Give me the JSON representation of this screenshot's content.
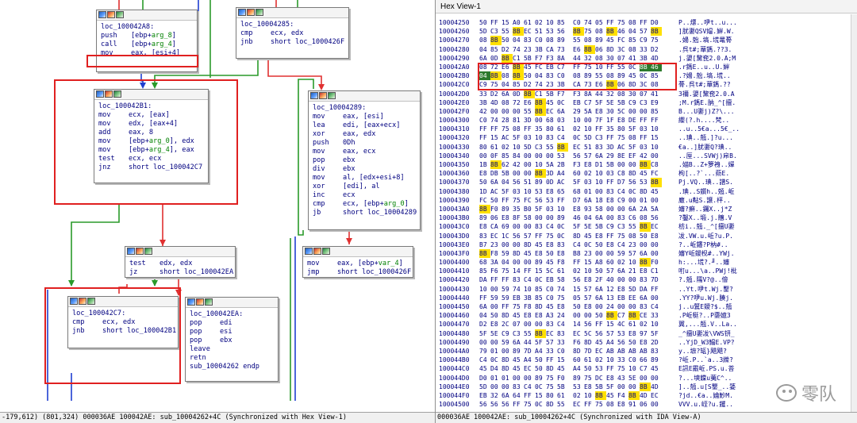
{
  "graph": {
    "status": "-179,612) (801,324) 000036AE 100042AE: sub_10004262+4C (Synchronized with Hex View-1)",
    "blocks": {
      "b1": {
        "label": "loc_100042A8:",
        "lines": [
          {
            "m": "push",
            "o": "[ebp+",
            "a": "arg_8",
            "t": "]"
          },
          {
            "m": "call",
            "o": "[ebp+",
            "a": "arg_4",
            "t": "]"
          },
          {
            "m": "mov",
            "o": "eax, [esi+4]",
            "a": "",
            "t": ""
          }
        ]
      },
      "b2": {
        "label": "loc_10004285:",
        "lines": [
          {
            "m": "cmp",
            "o": "ecx, edx",
            "a": "",
            "t": ""
          },
          {
            "m": "jnb",
            "o": "short loc_1000426F",
            "a": "",
            "t": ""
          }
        ]
      },
      "b3": {
        "label": "loc_100042B1:",
        "lines": [
          {
            "m": "mov",
            "o": "ecx, [eax]",
            "a": "",
            "t": ""
          },
          {
            "m": "mov",
            "o": "edx, [eax+4]",
            "a": "",
            "t": ""
          },
          {
            "m": "add",
            "o": "eax, 8",
            "a": "",
            "t": ""
          },
          {
            "m": "mov",
            "o": "[ebp+",
            "a": "arg_0",
            "t": "], edx"
          },
          {
            "m": "mov",
            "o": "[ebp+",
            "a": "arg_4",
            "t": "], eax"
          },
          {
            "m": "test",
            "o": "ecx, ecx",
            "a": "",
            "t": ""
          },
          {
            "m": "jnz",
            "o": "short loc_100042C7",
            "a": "",
            "t": ""
          }
        ]
      },
      "b4": {
        "label": "loc_10004289:",
        "lines": [
          {
            "m": "mov",
            "o": "eax, [esi]",
            "a": "",
            "t": ""
          },
          {
            "m": "lea",
            "o": "edi, [eax+ecx]",
            "a": "",
            "t": ""
          },
          {
            "m": "xor",
            "o": "eax, edx",
            "a": "",
            "t": ""
          },
          {
            "m": "push",
            "o": "0Dh",
            "a": "",
            "t": ""
          },
          {
            "m": "mov",
            "o": "eax, ecx",
            "a": "",
            "t": ""
          },
          {
            "m": "pop",
            "o": "ebx",
            "a": "",
            "t": ""
          },
          {
            "m": "div",
            "o": "ebx",
            "a": "",
            "t": ""
          },
          {
            "m": "mov",
            "o": "al, [edx+esi+8]",
            "a": "",
            "t": ""
          },
          {
            "m": "xor",
            "o": "[edi], al",
            "a": "",
            "t": ""
          },
          {
            "m": "inc",
            "o": "ecx",
            "a": "",
            "t": ""
          },
          {
            "m": "cmp",
            "o": "ecx, [ebp+",
            "a": "arg_0",
            "t": "]"
          },
          {
            "m": "jb",
            "o": "short loc_10004289",
            "a": "",
            "t": ""
          }
        ]
      },
      "b5": {
        "label": "",
        "lines": [
          {
            "m": "test",
            "o": "edx, edx",
            "a": "",
            "t": ""
          },
          {
            "m": "jz",
            "o": "short loc_100042EA",
            "a": "",
            "t": ""
          }
        ]
      },
      "b6": {
        "label": "",
        "lines": [
          {
            "m": "mov",
            "o": "eax, [ebp+",
            "a": "var_4",
            "t": "]"
          },
          {
            "m": "jmp",
            "o": "short loc_1000426F",
            "a": "",
            "t": ""
          }
        ]
      },
      "b7": {
        "label": "loc_100042C7:",
        "lines": [
          {
            "m": "cmp",
            "o": "ecx, edx",
            "a": "",
            "t": ""
          },
          {
            "m": "jnb",
            "o": "short loc_100042B1",
            "a": "",
            "t": ""
          }
        ]
      },
      "b8": {
        "label": "loc_100042EA:",
        "lines": [
          {
            "m": "pop",
            "o": "edi",
            "a": "",
            "t": ""
          },
          {
            "m": "pop",
            "o": "esi",
            "a": "",
            "t": ""
          },
          {
            "m": "pop",
            "o": "ebx",
            "a": "",
            "t": ""
          },
          {
            "m": "leave",
            "o": "",
            "a": "",
            "t": ""
          },
          {
            "m": "retn",
            "o": "",
            "a": "",
            "t": ""
          },
          {
            "m": "sub_10004262 endp",
            "o": "",
            "a": "",
            "t": ""
          }
        ]
      }
    }
  },
  "hex": {
    "title": "Hex View-1",
    "status": "000036AE 100042AE: sub_10004262+4C (Synchronized with IDA View-A)",
    "colors": {
      "highlight": "#ffe000",
      "cursor": "#2d7a2d",
      "redbox": "#e02020"
    },
    "rows": [
      {
        "addr": "10004250",
        "bytes": "50 FF 15 A0 61 02 10 85 C0 74 05 FF 75 08 FF D0",
        "hl": [],
        "ascii": "P..熛..吚t..u..."
      },
      {
        "addr": "10004260",
        "bytes": "5D C3 55 8B EC 51 53 56 8B 75 08 8B 46 04 57 8B",
        "hl": [
          3,
          8,
          11,
          15
        ],
        "ascii": "]肬嬱QSV媢.婩.W."
      },
      {
        "addr": "10004270",
        "bytes": "08 8B 50 04 83 C0 08 89 55 08 89 45 FC 85 C9 75",
        "hl": [
          1
        ],
        "ascii": ".婸.兝.塙.塃鼌蓇"
      },
      {
        "addr": "10004280",
        "bytes": "04 85 D2 74 23 3B CA 73 E6 8B 06 8D 3C 08 33 D2",
        "hl": [
          9
        ],
        "ascii": ".呉t#;蕇鎷.??3."
      },
      {
        "addr": "10004290",
        "bytes": "6A 0D 8B C1 5B F7 F3 8A 44 32 08 30 07 41 3B 4D",
        "hl": [
          2
        ],
        "ascii": "j.嬃[黧奃2.0.A;M"
      },
      {
        "addr": "100042A0",
        "bytes": "08 72 E6 8B 45 FC EB C7 FF 75 10 FF 55 0C 8B 46",
        "hl": [
          3
        ],
        "cursor": [
          14,
          15
        ],
        "ascii": ".r鎷E..u..U.婩"
      },
      {
        "addr": "100042B0",
        "bytes": "04 8B 08 8B 50 04 83 C0 08 89 55 08 89 45 0C 85",
        "hl": [
          1,
          3
        ],
        "cursor": [
          0
        ],
        "ascii": ".?婸.兝.塙.塃.."
      },
      {
        "addr": "100042C0",
        "bytes": "C9 75 04 85 D2 74 23 3B CA 73 E6 8B 06 8D 3C 08",
        "hl": [
          11
        ],
        "ascii": "蓇.呉t#;蕇鎷.??"
      },
      {
        "addr": "100042D0",
        "bytes": "33 D2 6A 0D 8B C1 5B F7 F3 8A 44 32 08 30 07 41",
        "hl": [
          4
        ],
        "ascii": "3襧.嬃[黧奃2.0.A"
      },
      {
        "addr": "100042E0",
        "bytes": "3B 4D 08 72 E6 8B 45 0C EB C7 5F 5E 5B C9 C3 E9",
        "hl": [
          5
        ],
        "ascii": ";M.r鎷E.肭_^[擅."
      },
      {
        "addr": "100042F0",
        "bytes": "42 00 00 00 55 8B EC 6A 29 5A E8 30 5C 00 00 85",
        "hl": [
          5
        ],
        "ascii": "B...U嬱j)Z?\\..."
      },
      {
        "addr": "10004300",
        "bytes": "C0 74 28 81 3D 00 68 03 10 00 7F 1F E8 DE FF FF",
        "hl": [],
        "ascii": "纓(?.h....梵.."
      },
      {
        "addr": "10004310",
        "bytes": "FF FF 75 08 FF 35 80 61 02 10 FF 35 80 5F 03 10",
        "hl": [],
        "ascii": "..u..5€a...5€_.."
      },
      {
        "addr": "10004320",
        "bytes": "FF 15 AC 5F 03 10 83 C4 0C 5D C3 FF 75 08 FF 15",
        "hl": [],
        "ascii": "..琠..兡.]?u..."
      },
      {
        "addr": "10004330",
        "bytes": "80 61 02 10 5D C3 55 8B EC 51 83 3D AC 5F 03 10",
        "hl": [
          7
        ],
        "ascii": "€a..]肬嬱Q?琠.."
      },
      {
        "addr": "10004340",
        "bytes": "00 0F 85 84 00 00 00 53 56 57 6A 29 8E EF 42 00",
        "hl": [],
        "ascii": "..厔...SVWj)帍B."
      },
      {
        "addr": "10004350",
        "bytes": "1B 8B 62 42 00 10 5A 2B F3 E8 D1 5B 00 00 8B C8",
        "hl": [
          1,
          14
        ],
        "ascii": ".媌B..Z+箩裑..嬋"
      },
      {
        "addr": "10004360",
        "bytes": "E8 DB 5B 00 00 8B 3D A4 60 02 10 03 C8 8D 45 FC",
        "hl": [
          5
        ],
        "ascii": "枸[..?`...葝E."
      },
      {
        "addr": "10004370",
        "bytes": "50 6A 04 56 51 89 0D AC 5F 03 10 FF D7 56 53 8B",
        "hl": [
          15
        ],
        "ascii": "Pj.VQ..琠..譜S."
      },
      {
        "addr": "10004380",
        "bytes": "1D AC 5F 03 10 53 E8 65 68 01 00 83 C4 0C 8D 45",
        "hl": [],
        "ascii": ".琠..S鑕h..兡.岴"
      },
      {
        "addr": "10004390",
        "bytes": "FC 50 FF 75 FC 56 53 FF D7 6A 18 E8 C9 00 01 00",
        "hl": [],
        "ascii": "黀.u黇S.譲.枰.."
      },
      {
        "addr": "100043A0",
        "bytes": "8B F0 89 35 B0 5F 03 10 E8 93 58 00 00 6A 2A 5A",
        "hl": [
          0
        ],
        "ascii": "嬸?癬..钃X..j*Z"
      },
      {
        "addr": "100043B0",
        "bytes": "89 06 E8 8F 58 00 00 89 46 04 6A 00 83 C6 08 56",
        "hl": [],
        "ascii": "?鑿X..塅.j.兤.V"
      },
      {
        "addr": "100043C0",
        "bytes": "E8 CA 69 00 00 83 C4 0C 5F 5E 5B C9 C3 55 8B EC",
        "hl": [
          14
        ],
        "ascii": "枋i..兡._^[擅U嬱"
      },
      {
        "addr": "100043D0",
        "bytes": "83 EC 1C 56 57 FF 75 0C 8D 45 E8 FF 75 08 50 E8",
        "hl": [],
        "ascii": "冹.VW.u.岴?u.P."
      },
      {
        "addr": "100043E0",
        "bytes": "B7 23 00 00 8D 45 E8 83 C4 0C 50 E8 C4 23 00 00",
        "hl": [],
        "ascii": "?..岴鑳?P枘#.."
      },
      {
        "addr": "100043F0",
        "bytes": "8B F8 59 8D 45 E8 50 E8 B8 23 00 00 59 57 6A 00",
        "hl": [
          0
        ],
        "ascii": "嬸Y岴鑀枧#..YWj."
      },
      {
        "addr": "10004400",
        "bytes": "68 3A 04 00 00 89 45 F8 FF 15 A8 60 02 10 8B F0",
        "hl": [
          14
        ],
        "ascii": "h:...塃?.╜..嬸"
      },
      {
        "addr": "10004410",
        "bytes": "85 F6 75 14 FF 15 5C 61 02 10 50 57 6A 21 E8 C1",
        "hl": [],
        "ascii": "咑u...\\a..PWj!枇"
      },
      {
        "addr": "10004420",
        "bytes": "DA FF FF 83 C4 0C EB 58 56 E8 2F 40 00 00 83 7D",
        "hl": [],
        "ascii": "?.兡.隭V?@..儈"
      },
      {
        "addr": "10004430",
        "bytes": "10 00 59 74 10 85 C0 74 15 57 6A 12 E8 5D DA FF",
        "hl": [],
        "ascii": "..Yt.吚t.Wj.鑋?"
      },
      {
        "addr": "10004440",
        "bytes": "FF 59 59 EB 3B 85 C0 75 05 57 6A 13 EB EE 6A 00",
        "hl": [],
        "ascii": ".YY?吚u.Wj.腠j."
      },
      {
        "addr": "10004450",
        "bytes": "6A 00 FF 75 F8 8D 45 E8 50 E8 00 24 00 00 83 C4",
        "hl": [],
        "ascii": "j..u鼚E鑀?$..兡"
      },
      {
        "addr": "10004460",
        "bytes": "04 50 8D 45 E8 E8 A3 24 00 00 50 8B C7 8B CE 33",
        "hl": [
          11,
          13
        ],
        "ascii": ".P岴梃?..P嬊嬑3"
      },
      {
        "addr": "10004470",
        "bytes": "D2 E8 2C 07 00 00 83 C4 14 56 FF 15 4C 61 02 10",
        "hl": [],
        "ascii": "翼,...兡.V..La.."
      },
      {
        "addr": "10004480",
        "bytes": "5F 5E C9 C3 55 8B EC 83 EC 5C 56 57 53 E8 97 5F",
        "hl": [
          5
        ],
        "ascii": "_^擅U嬱冹\\VWS钘_"
      },
      {
        "addr": "10004490",
        "bytes": "00 00 59 6A 44 5F 57 33 F6 8D 45 A4 56 50 E8 2D",
        "hl": [],
        "ascii": "..YjD_W3鰨E.VP?"
      },
      {
        "addr": "100044A0",
        "bytes": "79 01 00 89 7D A4 33 C0 8D 7D EC AB AB AB AB 83",
        "hl": [],
        "ascii": "y..墌?缻}飓飓?"
      },
      {
        "addr": "100044B0",
        "bytes": "C4 0C 8D 45 A4 50 FF 15 60 61 02 10 33 C0 66 89",
        "hl": [],
        "ascii": "?岴.P..`a..3纅?"
      },
      {
        "addr": "100044C0",
        "bytes": "45 D4 8D 45 EC 50 8D 45 A4 50 53 FF 75 10 C7 45",
        "hl": [],
        "ascii": "E訊E霵岴.PS.u.荅"
      },
      {
        "addr": "100044D0",
        "bytes": "D0 01 01 00 00 89 75 F0 89 75 DC E8 43 5E 00 00",
        "hl": [],
        "ascii": "?...塽饓u荑C^.."
      },
      {
        "addr": "100044E0",
        "bytes": "5D 00 00 83 C4 0C 75 5B 53 E8 5B 5F 00 00 8B 4D",
        "hl": [
          14
        ],
        "ascii": "]..兡.u[S鑋_..婱"
      },
      {
        "addr": "100044F0",
        "bytes": "EB 32 6A 64 FF 15 80 61 02 10 8B 45 F4 8B 4D EC",
        "hl": [
          10,
          13
        ],
        "ascii": "?jd..€a..婨魦M."
      },
      {
        "addr": "10004500",
        "bytes": "56 56 56 FF 75 0C 8D 55 EC FF 75 08 E8 91 06 00",
        "hl": [],
        "ascii": "VVV.u.峌?u.钁.."
      }
    ]
  },
  "watermark": {
    "text": "零队"
  }
}
